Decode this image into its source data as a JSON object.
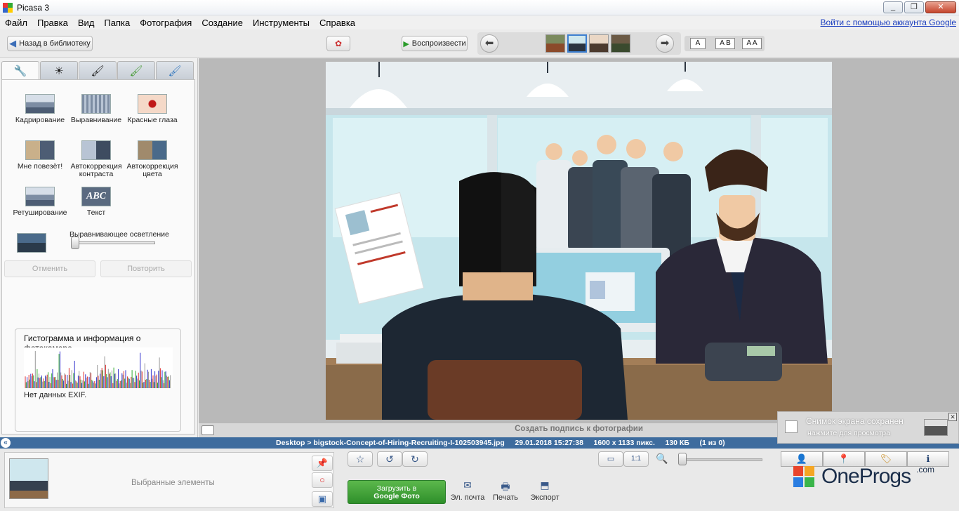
{
  "window": {
    "title": "Picasa 3",
    "min": "_",
    "max": "❐",
    "close": "✕"
  },
  "menu": {
    "items": [
      "Файл",
      "Правка",
      "Вид",
      "Папка",
      "Фотография",
      "Создание",
      "Инструменты",
      "Справка"
    ],
    "google_link": "Войти с помощью аккаунта Google"
  },
  "toolbar": {
    "back_label": "Назад в библиотеку",
    "play_label": "Воспроизвести",
    "view_modes": [
      "A",
      "A B",
      "A A"
    ]
  },
  "edit_panel": {
    "tabs": [
      "wrench",
      "sun",
      "brush",
      "green-brush",
      "blue-brush"
    ],
    "tools": [
      {
        "label": "Кадрирование"
      },
      {
        "label": "Выравнивание"
      },
      {
        "label": "Красные глаза"
      },
      {
        "label": "Мне повезёт!"
      },
      {
        "label": "Автокоррекция контраста"
      },
      {
        "label": "Автокоррекция цвета"
      },
      {
        "label": "Ретуширование"
      },
      {
        "label": "Текст"
      }
    ],
    "fill_light_label": "Выравнивающее осветление",
    "fill_light_value": 0,
    "undo_label": "Отменить",
    "redo_label": "Повторить",
    "histogram_title": "Гистограмма и информация о фотокамере",
    "exif_text": "Нет данных EXIF."
  },
  "viewer": {
    "caption_placeholder": "Создать подпись к фотографии"
  },
  "status": {
    "text": "Desktop > bigstock-Concept-of-Hiring-Recruiting-I-102503945.jpg     29.01.2018 15:27:38     1600 x 1133 пикс.     130 КБ     (1 из 0)"
  },
  "tray": {
    "selected_label": "Выбранные элементы",
    "upload_label_1": "Загрузить в",
    "upload_label_2": "Google Фото",
    "actions": [
      "Эл. почта",
      "Печать",
      "Экспорт"
    ],
    "zoom_buttons": [
      "▭",
      "1:1"
    ]
  },
  "notification": {
    "title": "Снимок экрана сохранен",
    "subtitle": "нажмите для просмотра"
  },
  "watermark": {
    "name": "OneProgs",
    "suffix": ".com"
  },
  "colors": {
    "statusbar": "#3e6c9e",
    "upload": "#2e8f2a",
    "link": "#1a3dbf"
  }
}
